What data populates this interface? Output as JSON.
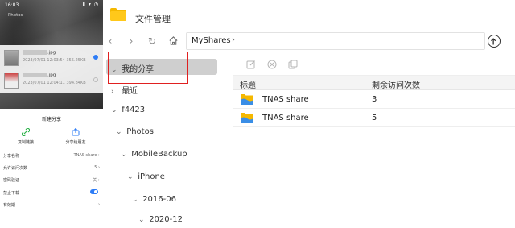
{
  "phone": {
    "status_time": "16:03",
    "status_icons": "▮ ▾ ◔",
    "breadcrumb": "‹ Photos",
    "files": [
      {
        "ext": ".jpg",
        "meta": "2023/07/01 12:03:54 355.25KB",
        "selected": true
      },
      {
        "ext": ".jpg",
        "meta": "2023/07/01 12:04:11 394.84KB",
        "selected": false
      }
    ],
    "sheet": {
      "title": "新建分享",
      "actions": [
        {
          "label": "复制链接",
          "icon": "link-icon"
        },
        {
          "label": "分享给朋友",
          "icon": "share-icon"
        }
      ],
      "options": [
        {
          "label": "分享名称",
          "value": "TNAS share ›"
        },
        {
          "label": "允许访问次数",
          "value": "5 ›"
        },
        {
          "label": "密码验证",
          "value": "关 ›"
        },
        {
          "label": "禁止下载",
          "value": ""
        },
        {
          "label": "有效期",
          "value": "›"
        }
      ]
    }
  },
  "app": {
    "title": "文件管理",
    "icon": "folder-icon",
    "accent": "#f5b800"
  },
  "nav": {
    "back": "‹",
    "forward": "›",
    "refresh": "↻",
    "home": "⌂",
    "path": "MyShares",
    "path_sep": "›",
    "upload": "↑"
  },
  "sidebar": {
    "items": [
      {
        "label": "我的分享",
        "arrow": "⌄",
        "selected": true
      },
      {
        "label": "最近",
        "arrow": "›"
      },
      {
        "label": "f4423",
        "arrow": "⌄"
      },
      {
        "label": "Photos",
        "arrow": "⌄"
      },
      {
        "label": "MobileBackup",
        "arrow": "⌄"
      },
      {
        "label": "iPhone",
        "arrow": "⌄"
      },
      {
        "label": "2016-06",
        "arrow": "⌄"
      },
      {
        "label": "2020-12",
        "arrow": "⌄"
      }
    ]
  },
  "toolbar": {
    "icons": [
      "edit-icon",
      "close-icon",
      "copy-icon"
    ]
  },
  "table": {
    "columns": [
      "标题",
      "剩余访问次数"
    ],
    "rows": [
      {
        "name": "TNAS share",
        "count": "3"
      },
      {
        "name": "TNAS share",
        "count": "5"
      }
    ]
  },
  "colors": {
    "highlight": "#e02020",
    "selected_bg": "#cfcfcf",
    "folder_blue": "#3a8ee6",
    "toggle_on": "#2d7cf6"
  }
}
